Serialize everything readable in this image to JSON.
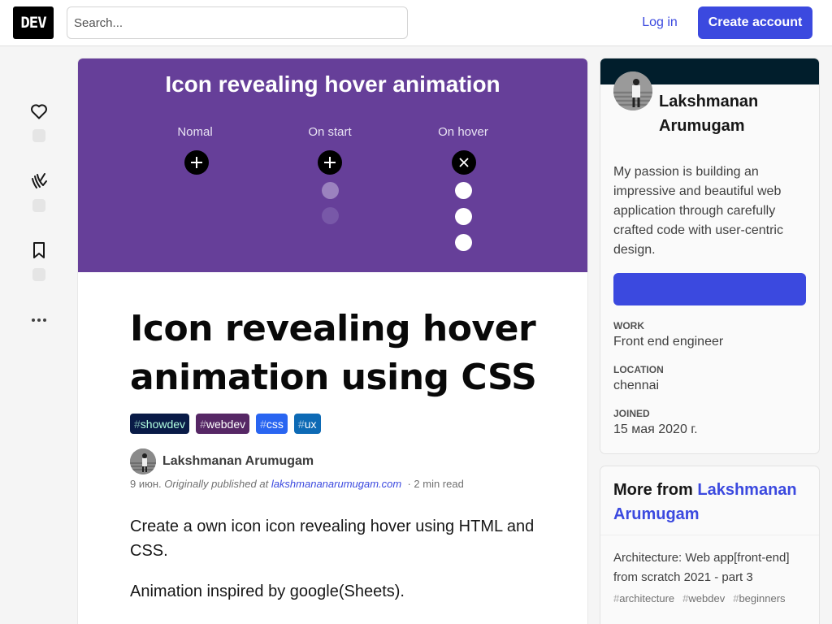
{
  "header": {
    "logo": "DEV",
    "search_placeholder": "Search...",
    "login_label": "Log in",
    "create_account_label": "Create account"
  },
  "reactions": {
    "icons": [
      "heart-icon",
      "unicorn-icon",
      "bookmark-icon"
    ],
    "more_icon": "more-horizontal-icon"
  },
  "cover": {
    "title": "Icon revealing hover animation",
    "columns": [
      "Nomal",
      "On start",
      "On hover"
    ],
    "color": "#663f99"
  },
  "article": {
    "title": "Icon revealing hover animation using CSS",
    "tags": [
      {
        "hash": "#",
        "name": "showdev",
        "bg": "#091b47",
        "fg": "#b2ffe1"
      },
      {
        "hash": "#",
        "name": "webdev",
        "bg": "#562765",
        "fg": "#ffffff"
      },
      {
        "hash": "#",
        "name": "css",
        "bg": "#2965f1",
        "fg": "#ffffff"
      },
      {
        "hash": "#",
        "name": "ux",
        "bg": "#0d6ab5",
        "fg": "#ffffff"
      }
    ],
    "author": "Lakshmanan Arumugam",
    "date": "9 июн.",
    "published_prefix": "Originally published at",
    "published_link": "lakshmananarumugam.com",
    "read_time": "2 min read",
    "paragraphs": [
      "Create a own icon icon revealing hover using HTML and CSS.",
      "Animation inspired by google(Sheets)."
    ]
  },
  "profile": {
    "name": "Lakshmanan Arumugam",
    "bio": "My passion is building an impressive and beautiful web application through carefully crafted code with user-centric design.",
    "follow_label": "",
    "details": [
      {
        "key": "WORK",
        "value": "Front end engineer"
      },
      {
        "key": "LOCATION",
        "value": "chennai"
      },
      {
        "key": "JOINED",
        "value": "15 мая 2020 г."
      }
    ]
  },
  "more_from": {
    "prefix": "More from",
    "author": "Lakshmanan Arumugam",
    "items": [
      {
        "title": "Architecture: Web app[front-end] from scratch 2021 - part 3",
        "tags": [
          "architecture",
          "webdev",
          "beginners"
        ]
      }
    ]
  },
  "colors": {
    "accent": "#3b49df",
    "cover_bg": "#663f99",
    "profile_band": "#011e2c"
  }
}
